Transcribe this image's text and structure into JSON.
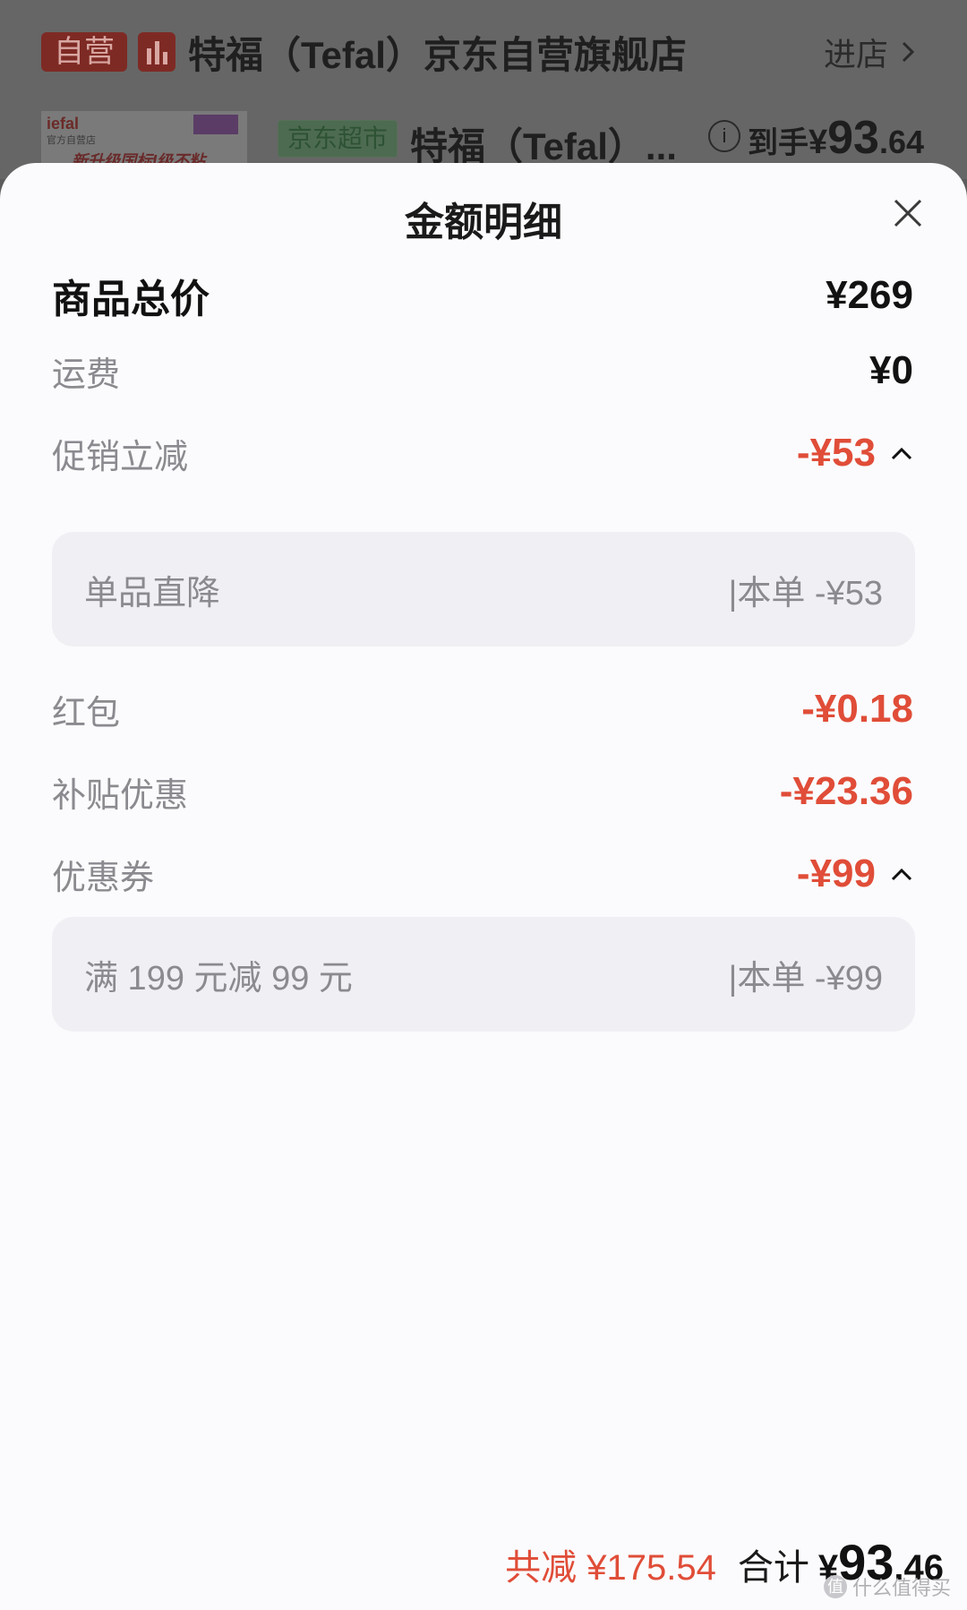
{
  "background": {
    "shop": {
      "badge": "自营",
      "name": "特福（Tefal）京东自营旗舰店",
      "enter_label": "进店"
    },
    "product": {
      "thumb_brand": "iefal",
      "thumb_brand_sub": "官方自营店",
      "thumb_slogan": "新升级国标I级不粘",
      "tag": "京东超市",
      "title": "特福（Tefal）...",
      "price_label": "到手",
      "price_currency": "¥",
      "price_int": "93",
      "price_dec": ".64"
    }
  },
  "sheet": {
    "title": "金额明细",
    "rows": {
      "total": {
        "label": "商品总价",
        "value": "¥269"
      },
      "shipping": {
        "label": "运费",
        "value": "¥0"
      },
      "promo": {
        "label": "促销立减",
        "value": "-¥53"
      },
      "promo_detail": {
        "label": "单品直降",
        "value": "|本单 -¥53"
      },
      "redpacket": {
        "label": "红包",
        "value": "-¥0.18"
      },
      "subsidy": {
        "label": "补贴优惠",
        "value": "-¥23.36"
      },
      "coupon": {
        "label": "优惠券",
        "value": "-¥99"
      },
      "coupon_detail": {
        "label": "满 199 元减 99 元",
        "value": "|本单 -¥99"
      }
    },
    "footer": {
      "saved": "共减 ¥175.54",
      "total_label": "合计",
      "currency": "¥",
      "total_int": "93",
      "total_dec": ".46"
    }
  },
  "watermark": {
    "text": "什么值得买",
    "icon": "值"
  },
  "colors": {
    "accent_red": "#e04d38",
    "sheet_bg": "#fbfbfd",
    "detail_bg": "#f0f0f4"
  }
}
